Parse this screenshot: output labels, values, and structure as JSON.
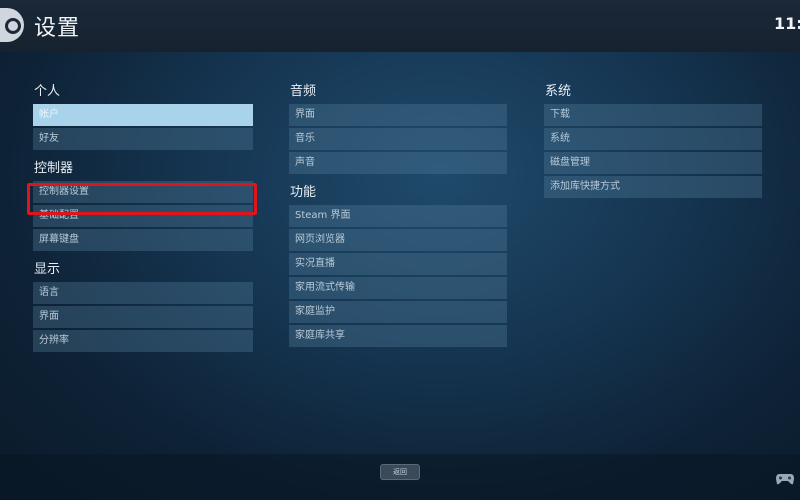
{
  "header": {
    "title": "设置",
    "clock": "11:"
  },
  "columns": [
    {
      "sections": [
        {
          "header": "个人",
          "items": [
            "帐户",
            "好友"
          ]
        },
        {
          "header": "控制器",
          "items": [
            "控制器设置",
            "基础配置",
            "屏幕键盘"
          ]
        },
        {
          "header": "显示",
          "items": [
            "语言",
            "界面",
            "分辨率"
          ]
        }
      ]
    },
    {
      "sections": [
        {
          "header": "音频",
          "items": [
            "界面",
            "音乐",
            "声音"
          ]
        },
        {
          "header": "功能",
          "items": [
            "Steam 界面",
            "网页浏览器",
            "实况直播",
            "家用流式传输",
            "家庭监护",
            "家庭库共享"
          ]
        }
      ]
    },
    {
      "sections": [
        {
          "header": "系统",
          "items": [
            "下载",
            "系统",
            "磁盘管理",
            "添加库快捷方式"
          ]
        }
      ]
    }
  ],
  "footer": {
    "back_label": "返回"
  },
  "icons": {
    "logo": "steam-logo-icon",
    "controller": "gamepad-icon"
  },
  "colors": {
    "selected_item": "#a9d3ea",
    "highlight_box": "#e0151b",
    "item_bg": "#4f7896"
  }
}
